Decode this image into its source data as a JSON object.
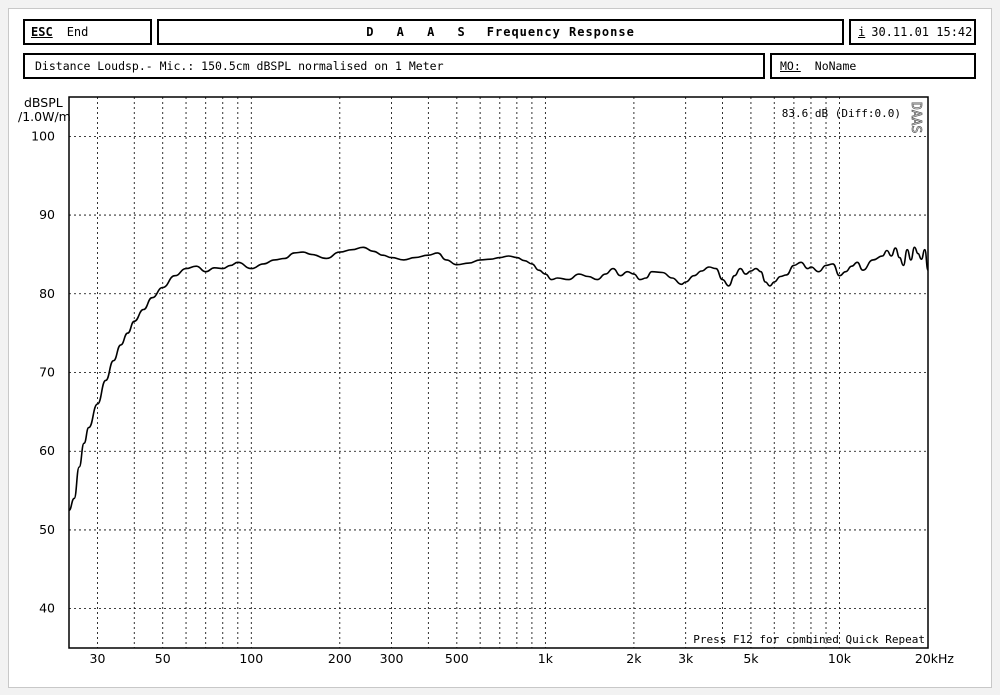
{
  "header": {
    "esc_key": "ESC",
    "esc_label": "End",
    "title_prefix": "D A A S",
    "title_main": "Frequency Response",
    "info_key": "i",
    "datetime": "30.11.01 15:42",
    "distance_text": "Distance Loudsp.- Mic.: 150.5cm dBSPL normalised on 1 Meter",
    "mo_key": "MO:",
    "mo_value": "NoName"
  },
  "chart_data": {
    "type": "line",
    "ylabel_line1": "dBSPL",
    "ylabel_line2": "/1.0W/m",
    "x_scale": "log",
    "xlim": [
      24,
      20000
    ],
    "ylim": [
      35,
      105
    ],
    "y_ticks": [
      40,
      50,
      60,
      70,
      80,
      90,
      100
    ],
    "x_ticks": [
      {
        "value": 30,
        "label": "30"
      },
      {
        "value": 50,
        "label": "50"
      },
      {
        "value": 100,
        "label": "100"
      },
      {
        "value": 200,
        "label": "200"
      },
      {
        "value": 300,
        "label": "300"
      },
      {
        "value": 500,
        "label": "500"
      },
      {
        "value": 1000,
        "label": "1k"
      },
      {
        "value": 2000,
        "label": "2k"
      },
      {
        "value": 3000,
        "label": "3k"
      },
      {
        "value": 5000,
        "label": "5k"
      },
      {
        "value": 10000,
        "label": "10k"
      },
      {
        "value": 20000,
        "label": "20kHz"
      }
    ],
    "x_grid": [
      30,
      40,
      50,
      60,
      70,
      80,
      90,
      100,
      200,
      300,
      400,
      500,
      600,
      700,
      800,
      900,
      1000,
      2000,
      3000,
      4000,
      5000,
      6000,
      7000,
      8000,
      9000,
      10000,
      20000
    ],
    "y_grid": [
      40,
      50,
      60,
      70,
      80,
      90,
      100
    ],
    "grid": true,
    "annotation_level": "83.6 dB (Diff:0.0)",
    "annotation_bottom": "Press F12 for combined Quick Repeat",
    "vertical_logo": "DAAS",
    "series": [
      {
        "x": [
          24,
          25,
          26,
          27,
          28,
          30,
          32,
          34,
          36,
          38,
          40,
          43,
          46,
          50,
          55,
          60,
          65,
          70,
          75,
          80,
          85,
          90,
          100,
          110,
          120,
          130,
          140,
          150,
          160,
          180,
          200,
          220,
          240,
          260,
          280,
          300,
          330,
          360,
          400,
          430,
          460,
          500,
          550,
          600,
          650,
          700,
          750,
          800,
          850,
          900,
          950,
          1000,
          1050,
          1100,
          1200,
          1300,
          1400,
          1500,
          1600,
          1700,
          1800,
          1900,
          2000,
          2100,
          2200,
          2300,
          2500,
          2700,
          2900,
          3000,
          3200,
          3400,
          3600,
          3800,
          4000,
          4200,
          4400,
          4600,
          4800,
          5000,
          5200,
          5400,
          5600,
          5800,
          6000,
          6300,
          6600,
          7000,
          7400,
          7800,
          8000,
          8500,
          9000,
          9500,
          10000,
          10500,
          11000,
          11500,
          12000,
          13000,
          14000,
          14500,
          15000,
          15500,
          16000,
          16500,
          17000,
          17500,
          18000,
          18500,
          19000,
          19500,
          20000
        ],
        "y": [
          52.5,
          54,
          58,
          61,
          63,
          66,
          69,
          71.5,
          73.5,
          75,
          76.5,
          78,
          79.5,
          80.8,
          82.3,
          83.2,
          83.5,
          82.8,
          83.3,
          83.2,
          83.6,
          84.0,
          83.2,
          83.8,
          84.3,
          84.5,
          85.2,
          85.3,
          85.0,
          84.5,
          85.3,
          85.6,
          85.9,
          85.4,
          84.9,
          84.6,
          84.3,
          84.6,
          84.9,
          85.2,
          84.3,
          83.7,
          83.9,
          84.3,
          84.4,
          84.6,
          84.8,
          84.6,
          84.2,
          83.8,
          83.0,
          82.5,
          81.8,
          82.0,
          81.8,
          82.5,
          82.2,
          81.8,
          82.5,
          83.2,
          82.3,
          82.8,
          82.5,
          81.8,
          82.0,
          82.8,
          82.7,
          82.0,
          81.2,
          81.5,
          82.3,
          82.9,
          83.4,
          83.2,
          81.8,
          81.0,
          82.3,
          83.2,
          82.5,
          82.9,
          83.2,
          82.8,
          81.5,
          81.0,
          81.5,
          82.2,
          82.4,
          83.6,
          84.0,
          83.2,
          83.4,
          82.8,
          83.6,
          83.8,
          82.3,
          82.8,
          83.5,
          84.0,
          83.0,
          84.3,
          84.8,
          85.5,
          84.8,
          85.8,
          84.6,
          83.6,
          85.6,
          84.3,
          85.9,
          85.1,
          84.4,
          85.6,
          83.0
        ]
      }
    ]
  }
}
